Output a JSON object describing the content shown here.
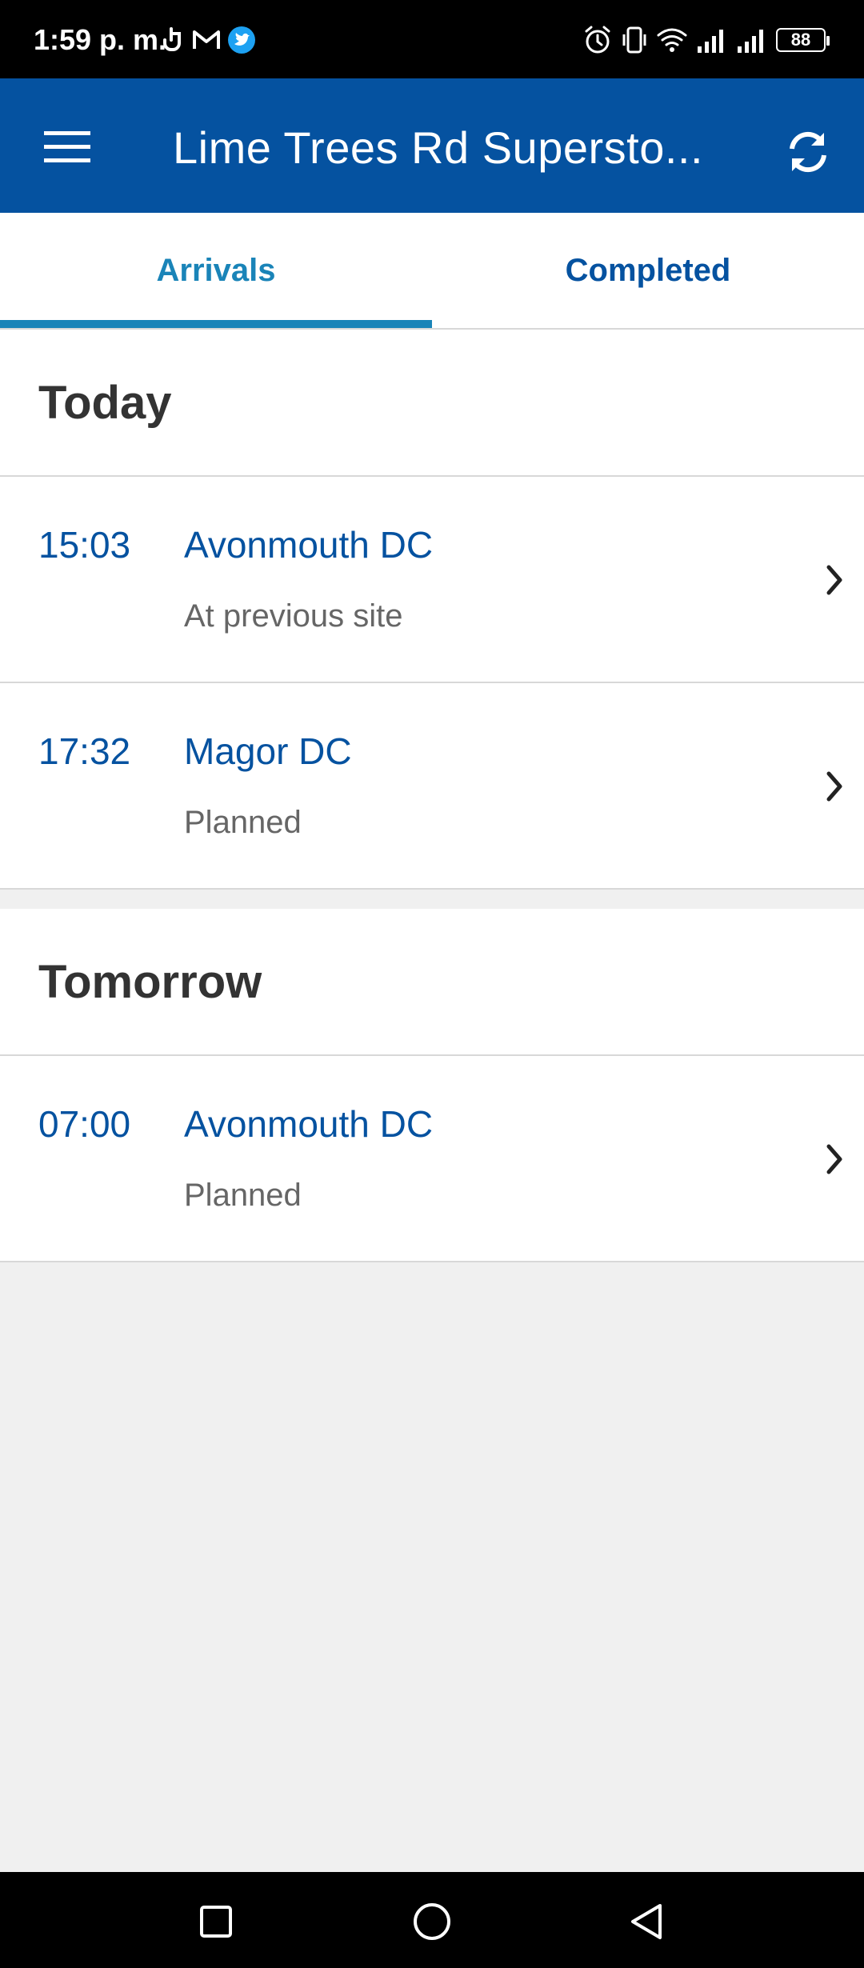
{
  "status_bar": {
    "time": "1:59 p. m.",
    "battery": "88"
  },
  "app_bar": {
    "title": "Lime Trees Rd Supersto..."
  },
  "tabs": [
    {
      "label": "Arrivals",
      "selected": true
    },
    {
      "label": "Completed",
      "selected": false
    }
  ],
  "sections": {
    "today": {
      "title": "Today",
      "rows": [
        {
          "time": "15:03",
          "destination": "Avonmouth DC",
          "status": "At previous site"
        },
        {
          "time": "17:32",
          "destination": "Magor DC",
          "status": "Planned"
        }
      ]
    },
    "tomorrow": {
      "title": "Tomorrow",
      "rows": [
        {
          "time": "07:00",
          "destination": "Avonmouth DC",
          "status": "Planned"
        }
      ]
    }
  },
  "colors": {
    "app_bar": "#0552a0",
    "accent": "#1a84b8",
    "link_text": "#0552a0",
    "background": "#f0f0f0"
  },
  "icons": [
    "menu-icon",
    "refresh-icon",
    "chevron-right-icon",
    "alarm-icon",
    "vibrate-icon",
    "wifi-icon",
    "signal-icon",
    "gmail-icon",
    "twitter-icon",
    "touch-icon"
  ]
}
